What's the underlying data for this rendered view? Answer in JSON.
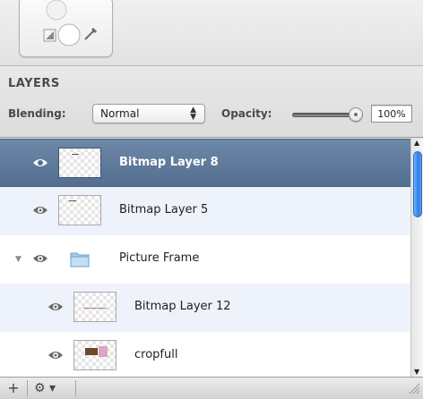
{
  "panel": {
    "title": "LAYERS",
    "blending_label": "Blending:",
    "blending_value": "Normal",
    "opacity_label": "Opacity:",
    "opacity_value": "100%",
    "opacity_level": 1.0
  },
  "layers": [
    {
      "name": "Bitmap Layer 8",
      "selected": true,
      "type": "bitmap",
      "visible": true
    },
    {
      "name": "Bitmap Layer 5",
      "selected": false,
      "type": "bitmap",
      "visible": true
    },
    {
      "name": "Picture Frame",
      "selected": false,
      "type": "folder",
      "expanded": true,
      "visible": true
    },
    {
      "name": "Bitmap Layer 12",
      "selected": false,
      "type": "bitmap",
      "visible": true,
      "child": true
    },
    {
      "name": "cropfull",
      "selected": false,
      "type": "bitmap",
      "visible": true,
      "child": true
    }
  ],
  "icons": {
    "eye": "eye-icon",
    "folder": "folder-icon",
    "add": "plus-icon",
    "gear": "gear-icon",
    "color_tool": "color-picker-icon"
  },
  "colors": {
    "selection": "#5b7696",
    "scroll_thumb": "#3b86e8"
  },
  "bottom_bar": {
    "add_label": "+",
    "gear_label": "⚙ ▾"
  }
}
